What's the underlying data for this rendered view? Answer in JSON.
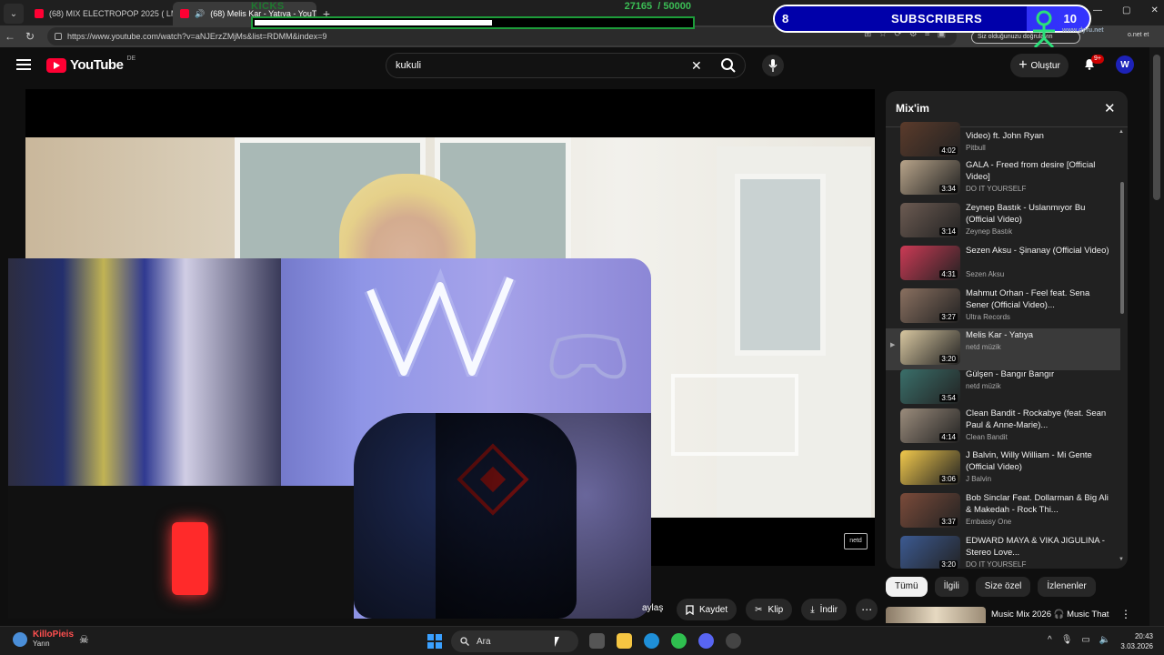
{
  "browser": {
    "tabs": [
      {
        "title": "(68) MIX ELECTROPOP 2025 ( LMF"
      },
      {
        "title": "(68) Melis Kar - Yatıya - YouTube"
      }
    ],
    "url": "https://www.youtube.com/watch?v=aNJErzZMjMs&list=RDMM&index=9",
    "cast_pill": "Siz olduğunuzu doğrulayın",
    "overlay_text": "o.net et"
  },
  "overlay": {
    "kicks": {
      "label": "KICKS",
      "current": "27165",
      "goal": "/ 50000",
      "progress": 0.54
    },
    "subscribers": {
      "current": "8",
      "label": "SUBSCRIBERS",
      "goal": "10",
      "progress": 0.8
    },
    "stream_url": "www.dyru.net"
  },
  "youtube": {
    "logo": "YouTube",
    "region": "DE",
    "search_value": "kukuli",
    "create_label": "Oluştur",
    "notification_count": "9+",
    "avatar_letter": "W",
    "video_watermark": "netd",
    "actions": {
      "share": "aylaş",
      "save": "Kaydet",
      "clip": "Klip",
      "download": "İndir"
    },
    "mix": {
      "title": "Mix'im",
      "items": [
        {
          "title": "Video) ft. John Ryan",
          "channel": "Pitbull",
          "duration": "4:02"
        },
        {
          "title": "GALA - Freed from desire [Official Video]",
          "channel": "DO IT YOURSELF",
          "duration": "3:34"
        },
        {
          "title": "Zeynep Bastık - Uslanmıyor Bu (Official Video)",
          "channel": "Zeynep Bastık",
          "duration": "3:14"
        },
        {
          "title": "Sezen Aksu - Şinanay (Official Video)",
          "channel": "Sezen Aksu",
          "duration": "4:31"
        },
        {
          "title": "Mahmut Orhan - Feel feat. Sena Sener (Official Video)...",
          "channel": "Ultra Records",
          "duration": "3:27"
        },
        {
          "title": "Melis Kar - Yatıya",
          "channel": "netd müzik",
          "duration": "3:20"
        },
        {
          "title": "Gülşen - Bangır Bangır",
          "channel": "netd müzik",
          "duration": "3:54"
        },
        {
          "title": "Clean Bandit - Rockabye (feat. Sean Paul & Anne-Marie)...",
          "channel": "Clean Bandit",
          "duration": "4:14"
        },
        {
          "title": "J Balvin, Willy William - Mi Gente (Official Video)",
          "channel": "J Balvin",
          "duration": "3:06"
        },
        {
          "title": "Bob Sinclar Feat. Dollarman & Big Ali & Makedah - Rock Thi...",
          "channel": "Embassy One",
          "duration": "3:37"
        },
        {
          "title": "EDWARD MAYA & VIKA JIGULINA - Stereo Love...",
          "channel": "DO IT YOURSELF",
          "duration": "3:20"
        }
      ]
    },
    "chips": [
      "Tümü",
      "İlgili",
      "Size özel",
      "İzlenenler"
    ],
    "shelf": {
      "title": "Music Mix 2026 🎧 Music That"
    }
  },
  "taskbar": {
    "weather_label": "Yarın",
    "news_label": "KilloPieis",
    "search_placeholder": "Ara",
    "time": "20:43",
    "date": "3.03.2026"
  }
}
